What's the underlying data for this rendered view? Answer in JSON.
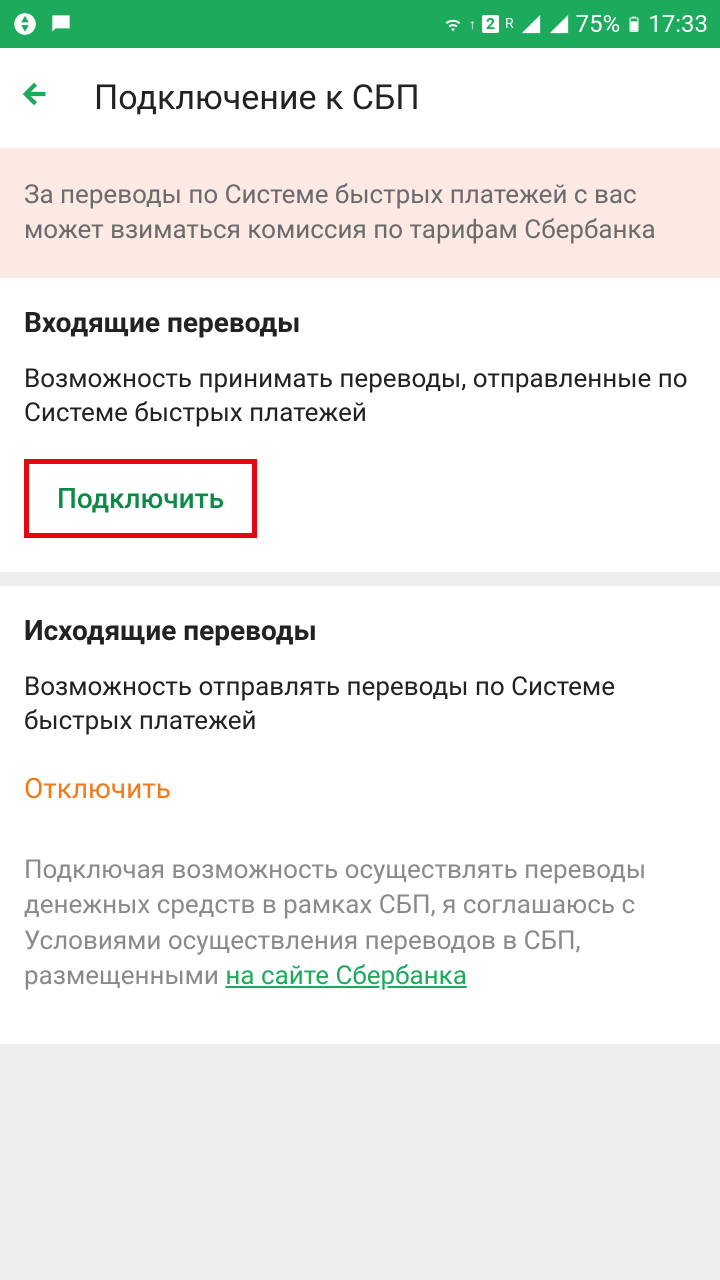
{
  "statusbar": {
    "sim": "2",
    "r": "R",
    "battery_pct": "75%",
    "time": "17:33"
  },
  "header": {
    "title": "Подключение к СБП"
  },
  "notice": {
    "text": "За переводы по Системе быстрых платежей с вас может взиматься комиссия по тарифам Сбербанка"
  },
  "incoming": {
    "title": "Входящие переводы",
    "desc": "Возможность принимать переводы, отправленные по Системе быстрых платежей",
    "button": "Подключить"
  },
  "outgoing": {
    "title": "Исходящие переводы",
    "desc": "Возможность отправлять переводы по Системе быстрых платежей",
    "button": "Отключить"
  },
  "footer": {
    "text": "Подключая возможность осуществлять переводы денежных средств в рамках СБП, я соглашаюсь с Условиями осуществления переводов в СБП, размещенными ",
    "link": "на сайте Сбербанка"
  }
}
